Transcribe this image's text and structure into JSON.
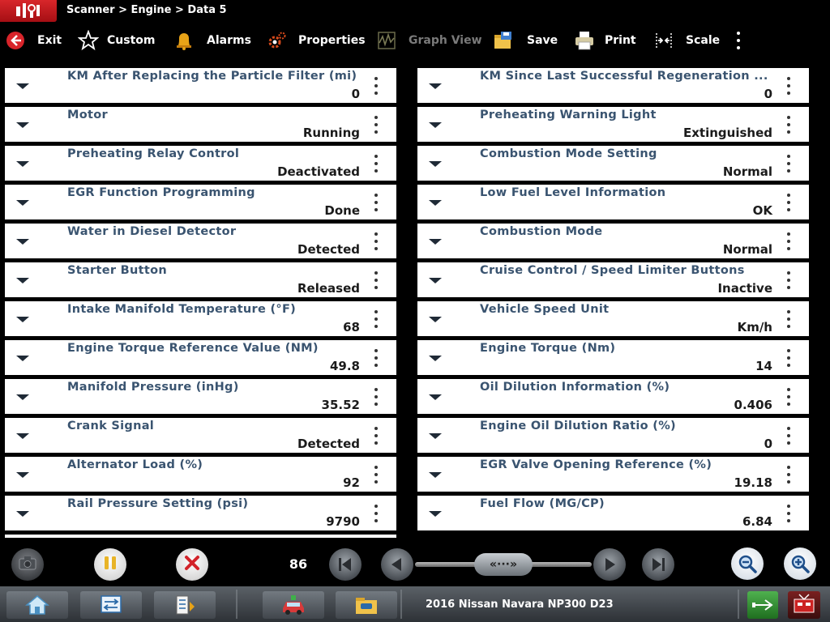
{
  "breadcrumb": "Scanner > Engine > Data 5",
  "toolbar": {
    "exit": "Exit",
    "custom": "Custom",
    "alarms": "Alarms",
    "properties": "Properties",
    "graph_view": "Graph View",
    "save": "Save",
    "print": "Print",
    "scale": "Scale"
  },
  "left_params": [
    {
      "name": "KM After Replacing the Particle Filter (mi)",
      "value": "0"
    },
    {
      "name": "Motor",
      "value": "Running"
    },
    {
      "name": "Preheating Relay Control",
      "value": "Deactivated"
    },
    {
      "name": "EGR Function Programming",
      "value": "Done"
    },
    {
      "name": "Water in Diesel Detector",
      "value": "Detected"
    },
    {
      "name": "Starter Button",
      "value": "Released"
    },
    {
      "name": "Intake Manifold Temperature (°F)",
      "value": "68"
    },
    {
      "name": "Engine Torque Reference Value (NM)",
      "value": "49.8"
    },
    {
      "name": "Manifold Pressure (inHg)",
      "value": "35.52"
    },
    {
      "name": "Crank Signal",
      "value": "Detected"
    },
    {
      "name": "Alternator Load (%)",
      "value": "92"
    },
    {
      "name": "Rail Pressure Setting (psi)",
      "value": "9790"
    }
  ],
  "right_params": [
    {
      "name": "KM Since Last Successful Regeneration ...",
      "value": "0"
    },
    {
      "name": "Preheating Warning Light",
      "value": "Extinguished"
    },
    {
      "name": "Combustion Mode Setting",
      "value": "Normal"
    },
    {
      "name": "Low Fuel Level Information",
      "value": "OK"
    },
    {
      "name": "Combustion Mode",
      "value": "Normal"
    },
    {
      "name": "Cruise Control / Speed Limiter Buttons",
      "value": "Inactive"
    },
    {
      "name": "Vehicle Speed Unit",
      "value": "Km/h"
    },
    {
      "name": "Engine Torque (Nm)",
      "value": "14"
    },
    {
      "name": "Oil Dilution Information (%)",
      "value": "0.406"
    },
    {
      "name": "Engine Oil Dilution Ratio (%)",
      "value": "0"
    },
    {
      "name": "EGR Valve Opening Reference (%)",
      "value": "19.18"
    },
    {
      "name": "Fuel Flow (MG/CP)",
      "value": "6.84"
    }
  ],
  "playback": {
    "counter": "86",
    "slider_thumb": "«···»"
  },
  "vehicle": "2016 Nissan Navara NP300 D23",
  "colors": {
    "param_name": "#3a5470",
    "param_value": "#1b1b1b",
    "row_bg": "#ffffff",
    "logo_red": "#c8181e"
  },
  "icons": {
    "exit": "exit-arrow-icon",
    "custom": "star-icon",
    "alarms": "bell-icon",
    "properties": "gear-icon",
    "graph_view": "graph-icon",
    "save": "save-folder-icon",
    "print": "printer-icon",
    "scale": "scale-icon",
    "more": "more-vertical-icon"
  }
}
